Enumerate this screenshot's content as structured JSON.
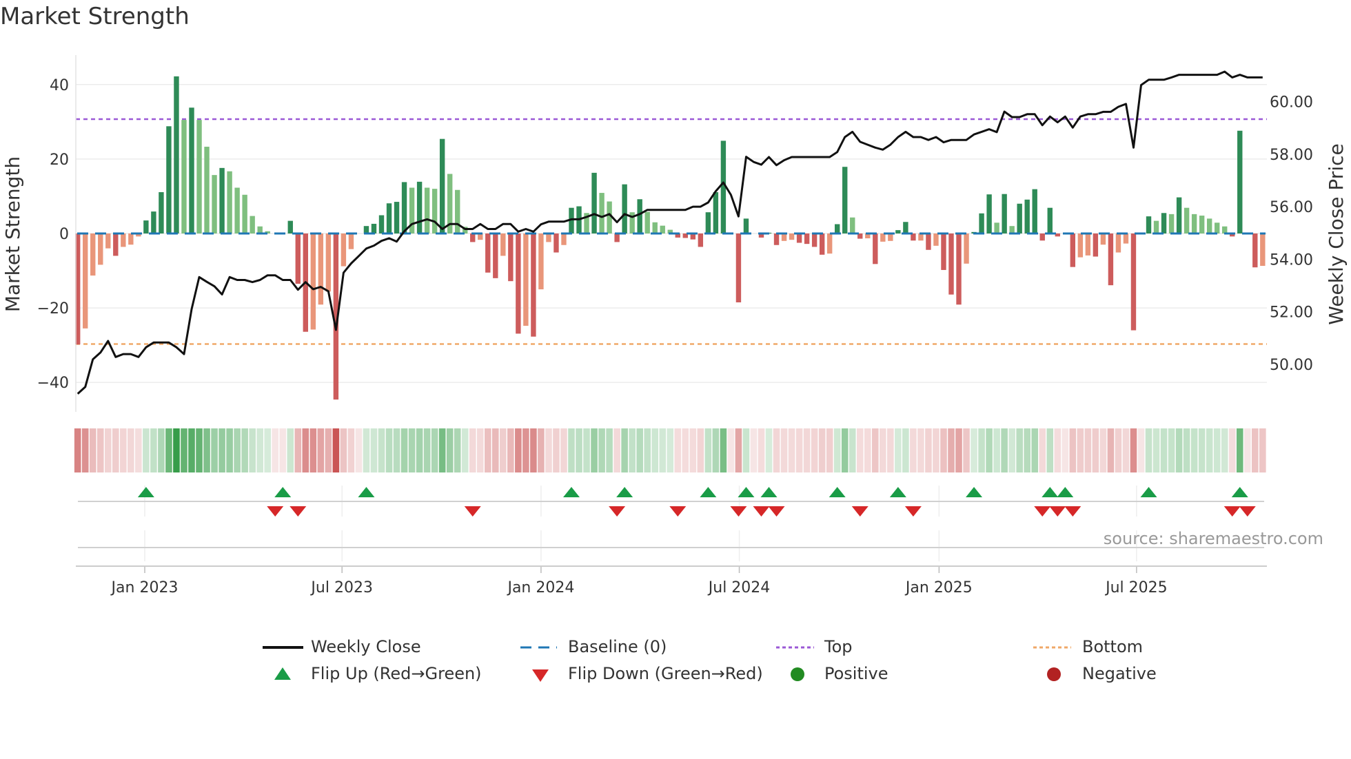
{
  "title": "Market Strength",
  "source": "source: sharemaestro.com",
  "colors": {
    "pos_dark": "#2e8b57",
    "pos_light": "#7fbf7f",
    "neg_dark": "#cd5c5c",
    "neg_light": "#e9967a",
    "close": "#111111",
    "baseline": "#1f77b4",
    "top": "#9b59d6",
    "bottom": "#f0a868",
    "flip_up": "#1a9c47",
    "flip_down": "#d62728",
    "positive": "#228b22",
    "negative": "#b22222"
  },
  "legend": {
    "weekly_close": "Weekly Close",
    "baseline": "Baseline (0)",
    "top": "Top",
    "bottom": "Bottom",
    "flip_up": "Flip Up (Red→Green)",
    "flip_down": "Flip Down (Green→Red)",
    "positive": "Positive",
    "negative": "Negative"
  },
  "chart_data": {
    "type": "bar",
    "title": "Market Strength",
    "ylabel": "Market Strength",
    "y2label": "Weekly Close Price",
    "ylim": [
      -48,
      48
    ],
    "y2lim": [
      48.2,
      61.75
    ],
    "yticks": [
      "40",
      "20",
      "0",
      "−20",
      "−40"
    ],
    "ytick_values": [
      40,
      20,
      0,
      -20,
      -40
    ],
    "y2ticks": [
      "50.00",
      "52.00",
      "54.00",
      "56.00",
      "58.00",
      "60.00"
    ],
    "y2tick_values": [
      50,
      52,
      54,
      56,
      58,
      60
    ],
    "x_ticks": [
      {
        "label": "Jan 2023",
        "week": 8.83
      },
      {
        "label": "Jul 2023",
        "week": 34.8
      },
      {
        "label": "Jan 2024",
        "week": 61.0
      },
      {
        "label": "Jul 2024",
        "week": 87.1
      },
      {
        "label": "Jan 2025",
        "week": 113.4
      },
      {
        "label": "Jul 2025",
        "week": 139.4
      }
    ],
    "top_level": 30.7,
    "bottom_level": -29.7,
    "baseline": 0,
    "strength": [
      -29.8,
      -25.5,
      -11.3,
      -8.4,
      -4,
      -6,
      -3.6,
      -3,
      -0.8,
      3.5,
      5.9,
      11.1,
      28.8,
      42.2,
      30.5,
      33.8,
      30.5,
      23.3,
      15.7,
      17.6,
      16.7,
      12.3,
      10.4,
      4.7,
      1.9,
      0.6,
      0,
      0,
      3.4,
      -13.5,
      -26.4,
      -25.8,
      -19.1,
      -15.6,
      -44.6,
      -8.8,
      -4.2,
      0,
      2,
      2.6,
      4.9,
      8.1,
      8.5,
      13.8,
      12.3,
      13.9,
      12.3,
      12,
      25.4,
      16,
      11.7,
      1.8,
      -2.3,
      -1.7,
      -10.5,
      -12,
      -6,
      -12.8,
      -26.9,
      -24.8,
      -27.7,
      -15,
      -2.3,
      -5.1,
      -3.1,
      6.9,
      7.3,
      5.5,
      16.3,
      10.9,
      8.6,
      -2.3,
      13.2,
      5.7,
      9.2,
      5.8,
      3,
      2.1,
      1,
      -1.1,
      -1.2,
      -1.6,
      -3.6,
      5.7,
      11.1,
      24.9,
      0,
      -18.5,
      4,
      0,
      -1.1,
      0.2,
      -3.1,
      -2,
      -1.7,
      -2.5,
      -2.8,
      -3.6,
      -5.7,
      -5.4,
      2.5,
      17.9,
      4.3,
      -1.4,
      -1.3,
      -8.2,
      -2.2,
      -2,
      0.9,
      3.1,
      -1.9,
      -1.9,
      -4.4,
      -3.3,
      -9.8,
      -16.4,
      -19.1,
      -8.1,
      0.4,
      5.4,
      10.5,
      2.9,
      10.6,
      2,
      8,
      9.1,
      11.9,
      -1.9,
      6.9,
      -0.8,
      0,
      -9,
      -6.4,
      -5.9,
      -6.2,
      -3,
      -13.9,
      -5.1,
      -2.7,
      -26,
      0,
      4.6,
      3.4,
      5.5,
      5.2,
      9.7,
      6.9,
      5.2,
      4.8,
      4,
      2.9,
      1.9,
      -0.8,
      27.6,
      0,
      -9.1,
      -8.7
    ],
    "shade": [
      "d",
      "l",
      "l",
      "l",
      "l",
      "d",
      "l",
      "l",
      "l",
      "d",
      "d",
      "d",
      "d",
      "d",
      "l",
      "d",
      "l",
      "l",
      "l",
      "d",
      "l",
      "l",
      "l",
      "l",
      "l",
      "l",
      "l",
      "l",
      "d",
      "d",
      "d",
      "l",
      "l",
      "l",
      "d",
      "l",
      "l",
      "l",
      "d",
      "d",
      "d",
      "d",
      "d",
      "d",
      "l",
      "d",
      "l",
      "l",
      "d",
      "l",
      "l",
      "l",
      "d",
      "l",
      "d",
      "d",
      "l",
      "d",
      "d",
      "l",
      "d",
      "l",
      "l",
      "d",
      "l",
      "d",
      "d",
      "l",
      "d",
      "l",
      "l",
      "d",
      "d",
      "l",
      "d",
      "l",
      "l",
      "l",
      "l",
      "d",
      "d",
      "d",
      "d",
      "d",
      "d",
      "d",
      "l",
      "d",
      "d",
      "l",
      "d",
      "d",
      "d",
      "l",
      "l",
      "d",
      "d",
      "d",
      "d",
      "l",
      "d",
      "d",
      "l",
      "d",
      "l",
      "d",
      "l",
      "l",
      "d",
      "d",
      "d",
      "l",
      "d",
      "l",
      "d",
      "d",
      "d",
      "l",
      "d",
      "d",
      "d",
      "l",
      "d",
      "l",
      "d",
      "d",
      "d",
      "d",
      "d",
      "d",
      "l",
      "d",
      "l",
      "l",
      "d",
      "l",
      "d",
      "l",
      "l",
      "d",
      "l",
      "d",
      "l",
      "d",
      "l",
      "d",
      "l",
      "l",
      "l",
      "l",
      "l",
      "l",
      "d",
      "d",
      "l",
      "d",
      "l"
    ],
    "weekly_close": [
      48.88,
      49.14,
      50.19,
      50.45,
      50.89,
      50.28,
      50.39,
      50.39,
      50.28,
      50.65,
      50.83,
      50.83,
      50.83,
      50.65,
      50.39,
      52.1,
      53.32,
      53.14,
      52.97,
      52.66,
      53.32,
      53.21,
      53.21,
      53.13,
      53.21,
      53.39,
      53.39,
      53.21,
      53.21,
      52.84,
      53.13,
      52.86,
      52.95,
      52.78,
      51.31,
      53.49,
      53.84,
      54.12,
      54.41,
      54.52,
      54.7,
      54.8,
      54.67,
      55.07,
      55.34,
      55.43,
      55.52,
      55.43,
      55.15,
      55.34,
      55.34,
      55.15,
      55.15,
      55.34,
      55.15,
      55.15,
      55.34,
      55.34,
      55.05,
      55.15,
      55.05,
      55.33,
      55.43,
      55.43,
      55.43,
      55.52,
      55.52,
      55.61,
      55.72,
      55.61,
      55.72,
      55.41,
      55.72,
      55.61,
      55.72,
      55.88,
      55.88,
      55.88,
      55.88,
      55.88,
      55.88,
      56.0,
      56.0,
      56.16,
      56.59,
      56.92,
      56.45,
      55.63,
      57.9,
      57.7,
      57.6,
      57.89,
      57.58,
      57.77,
      57.89,
      57.89,
      57.89,
      57.89,
      57.89,
      57.89,
      58.08,
      58.65,
      58.85,
      58.47,
      58.36,
      58.25,
      58.17,
      58.36,
      58.65,
      58.85,
      58.65,
      58.65,
      58.54,
      58.65,
      58.45,
      58.54,
      58.54,
      58.54,
      58.75,
      58.85,
      58.95,
      58.84,
      59.62,
      59.41,
      59.41,
      59.52,
      59.52,
      59.1,
      59.43,
      59.21,
      59.43,
      59.01,
      59.43,
      59.52,
      59.52,
      59.61,
      59.61,
      59.8,
      59.91,
      58.25,
      60.63,
      60.83,
      60.83,
      60.83,
      60.92,
      61.02,
      61.02,
      61.02,
      61.02,
      61.02,
      61.02,
      61.14,
      60.92,
      61.02,
      60.92,
      60.92,
      60.92
    ],
    "flip_up_weeks": [
      9,
      27,
      38,
      65,
      72,
      83,
      88,
      91,
      100,
      108,
      118,
      128,
      130,
      141,
      153
    ],
    "flip_down_weeks": [
      26,
      29,
      52,
      71,
      79,
      87,
      90,
      92,
      103,
      110,
      127,
      129,
      131,
      152,
      154
    ],
    "legend_position": "bottom"
  }
}
